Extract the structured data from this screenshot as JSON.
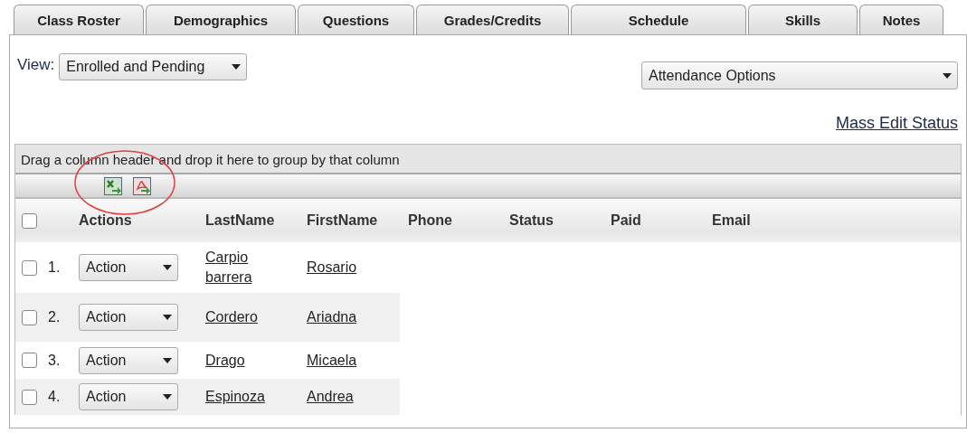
{
  "tabs": [
    "Class Roster",
    "Demographics",
    "Questions",
    "Grades/Credits",
    "Schedule",
    "Skills",
    "Notes"
  ],
  "view": {
    "label": "View:",
    "value": "Enrolled and Pending"
  },
  "attendance": {
    "value": "Attendance Options"
  },
  "mass_edit_link": "Mass Edit Status",
  "grid": {
    "group_hint": "Drag a column header and drop it here to group by that column",
    "columns": [
      "Actions",
      "LastName",
      "FirstName",
      "Phone",
      "Status",
      "Paid",
      "Email"
    ],
    "header_checked": false,
    "rows": [
      {
        "number": "1.",
        "checked": false,
        "action": "Action",
        "last_name": "Carpio barrera",
        "first_name": "Rosario"
      },
      {
        "number": "2.",
        "checked": false,
        "action": "Action",
        "last_name": "Cordero",
        "first_name": "Ariadna"
      },
      {
        "number": "3.",
        "checked": false,
        "action": "Action",
        "last_name": "Drago",
        "first_name": "Micaela"
      },
      {
        "number": "4.",
        "checked": false,
        "action": "Action",
        "last_name": "Espinoza",
        "first_name": "Andrea"
      }
    ]
  }
}
